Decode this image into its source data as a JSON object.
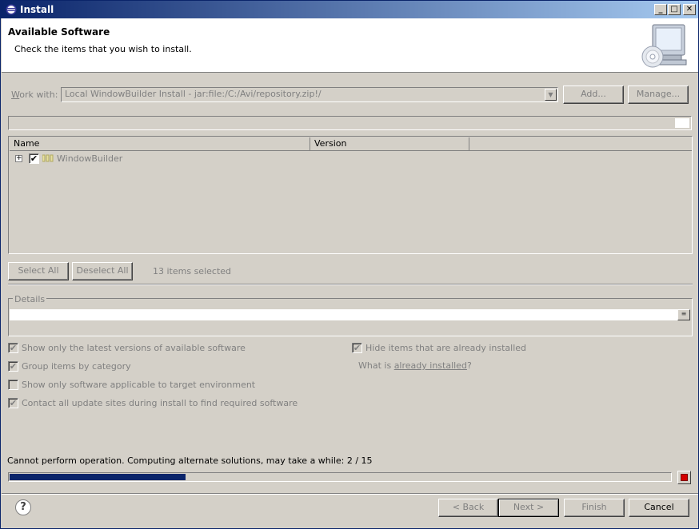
{
  "window": {
    "title": "Install",
    "controls": {
      "minimize": "_",
      "maximize": "□",
      "close": "✕"
    }
  },
  "header": {
    "title": "Available Software",
    "subtitle": "Check the items that you wish to install."
  },
  "work_with": {
    "label": "Work with:",
    "value": "Local WindowBuilder Install - jar:file:/C:/Avi/repository.zip!/",
    "add_label": "Add...",
    "manage_label": "Manage..."
  },
  "table": {
    "columns": [
      "Name",
      "Version"
    ],
    "rows": [
      {
        "name": "WindowBuilder",
        "version": "",
        "checked": true,
        "expanded": false
      }
    ]
  },
  "selection": {
    "select_all_label": "Select All",
    "deselect_all_label": "Deselect All",
    "count_text": "13 items selected"
  },
  "details": {
    "legend": "Details",
    "text": ""
  },
  "options": {
    "latest_versions": {
      "label": "Show only the latest versions of available software",
      "checked": true
    },
    "group_by_category": {
      "label": "Group items by category",
      "checked": true
    },
    "applicable_only": {
      "label": "Show only software applicable to target environment",
      "checked": false
    },
    "contact_sites": {
      "label": "Contact all update sites during install to find required software",
      "checked": true
    },
    "hide_installed": {
      "label": "Hide items that are already installed",
      "checked": true
    },
    "what_is_prefix": "What is ",
    "what_is_link": "already installed",
    "what_is_suffix": "?"
  },
  "status": {
    "message": "Cannot perform operation. Computing alternate solutions, may take a while: 2 / 15",
    "progress_fraction": 0.2667
  },
  "footer": {
    "help_icon": "?",
    "back_label": "< Back",
    "next_label": "Next >",
    "finish_label": "Finish",
    "cancel_label": "Cancel"
  },
  "colors": {
    "titlebar_start": "#0a246a",
    "titlebar_end": "#a6caf0",
    "progress": "#0a246a",
    "stop": "#d40000",
    "window_bg": "#d4d0c8"
  }
}
